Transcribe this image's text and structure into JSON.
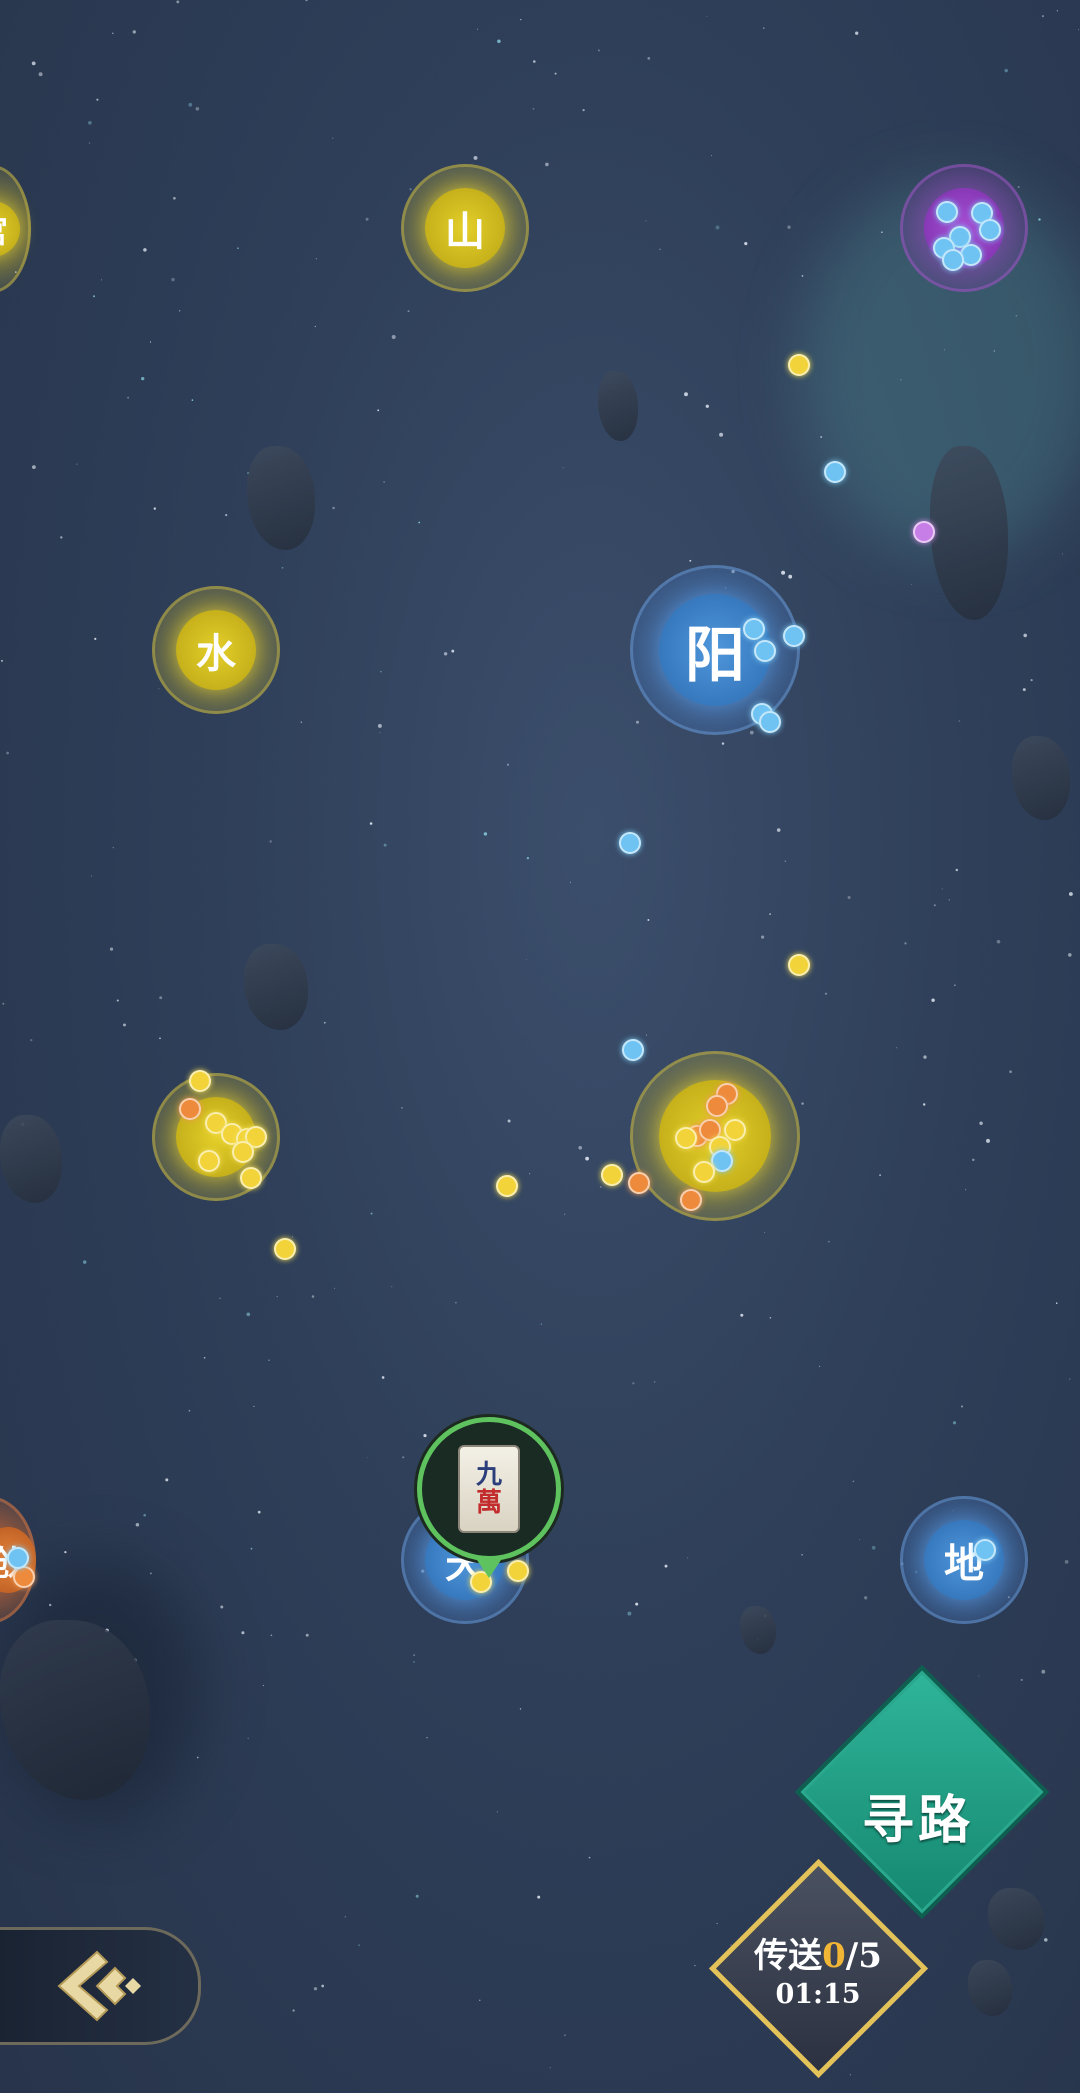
{
  "map": {
    "nodes": [
      {
        "id": "gong",
        "label": "宫",
        "color": "yellow",
        "visible": "partial"
      },
      {
        "id": "shan",
        "label": "山",
        "color": "yellow"
      },
      {
        "id": "purple-top",
        "label": "",
        "color": "purple"
      },
      {
        "id": "shui",
        "label": "水",
        "color": "yellow"
      },
      {
        "id": "yang",
        "label": "阳",
        "color": "blue"
      },
      {
        "id": "left-mid",
        "label": "",
        "color": "yellow"
      },
      {
        "id": "center-mid",
        "label": "",
        "color": "yellow"
      },
      {
        "id": "tian",
        "label": "天",
        "color": "blue"
      },
      {
        "id": "di",
        "label": "地",
        "color": "blue"
      },
      {
        "id": "orange-left",
        "label": "戗",
        "color": "orange",
        "visible": "partial"
      }
    ]
  },
  "player": {
    "line1": "九",
    "line2": "萬"
  },
  "buttons": {
    "pathfind": "寻路",
    "teleport_label": "传送",
    "teleport_count": "0",
    "teleport_max": "/5",
    "timer": "01:15"
  },
  "colors": {
    "pathfind": "#1fa385",
    "teleport_border": "#e4c25a",
    "background": "#2f3f59"
  }
}
